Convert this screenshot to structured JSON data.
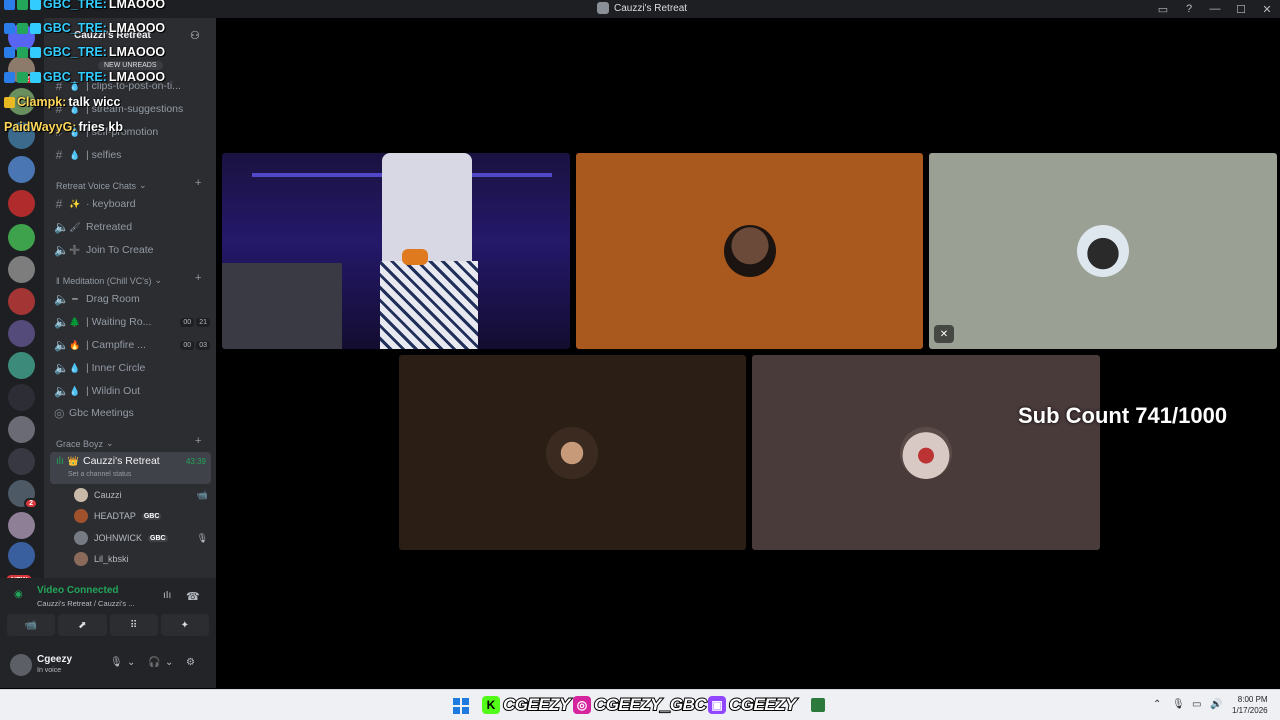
{
  "window": {
    "title": "Cauzzi's Retreat"
  },
  "server": {
    "name": "Cauzzi's Retreat",
    "new_unreads": "NEW UNREADS"
  },
  "rail": {
    "badges": [
      "27",
      "2"
    ],
    "new_label": "NEW"
  },
  "channels": [
    {
      "label": "| clips-to-post-on-ti...",
      "emoji": "💧"
    },
    {
      "label": "| stream-suggestions",
      "emoji": "💧"
    },
    {
      "label": "| self-promotion",
      "emoji": "💧"
    },
    {
      "label": "| selfies",
      "emoji": "💧"
    }
  ],
  "categories": {
    "retreat": "Retreat Voice Chats",
    "meditation": "Meditation (Chill VC's)",
    "grace": "Grace Boyz"
  },
  "retreat_channels": [
    {
      "label": "· keyboard",
      "emoji": "✨"
    },
    {
      "label": "Retreated",
      "emoji": "🖌"
    },
    {
      "label": "Join To Create",
      "emoji": "➕"
    }
  ],
  "meditation_channels": [
    {
      "label": "Drag Room",
      "emoji": "━",
      "counts": []
    },
    {
      "label": "| Waiting Ro...",
      "emoji": "🌲",
      "counts": [
        "00",
        "21"
      ]
    },
    {
      "label": "| Campfire ...",
      "emoji": "🔥",
      "counts": [
        "00",
        "03"
      ]
    },
    {
      "label": "| Inner Circle",
      "emoji": "💧",
      "counts": []
    },
    {
      "label": "| Wildin Out",
      "emoji": "💧",
      "counts": []
    },
    {
      "label": "Gbc Meetings",
      "emoji": "",
      "counts": []
    }
  ],
  "active_channel": {
    "name": "Cauzzi's Retreat",
    "time": "43:39",
    "status": "Set a channel status"
  },
  "members": [
    {
      "name": "Cauzzi",
      "tag": "",
      "icon": "📹",
      "color": "#c9b9a8"
    },
    {
      "name": "HEADTAP",
      "tag": "GBC",
      "icon": "",
      "color": "#a0522d"
    },
    {
      "name": "JOHNWICK",
      "tag": "GBC",
      "icon": "🎙",
      "color": "#777b83"
    },
    {
      "name": "Lil_kbski",
      "tag": "",
      "icon": "",
      "color": "#8a6b5a"
    }
  ],
  "voice": {
    "status": "Video Connected",
    "sub": "Cauzzi's Retreat / Cauzzi's ...",
    "buttons": [
      "📹",
      "⬈",
      "⠿",
      "✦"
    ]
  },
  "user": {
    "name": "Cgeezy",
    "status": "In voice"
  },
  "chat": [
    {
      "name": "GBC_TRE:",
      "msg": "LMAOOO",
      "color": "cyan"
    },
    {
      "name": "GBC_TRE:",
      "msg": "LMAOOO",
      "color": "cyan"
    },
    {
      "name": "GBC_TRE:",
      "msg": "LMAOOO",
      "color": "cyan"
    },
    {
      "name": "GBC_TRE:",
      "msg": "LMAOOO",
      "color": "cyan"
    },
    {
      "name": "Clampk:",
      "msg": "talk wicc",
      "color": "yellow"
    },
    {
      "name": "PaidWayyG:",
      "msg": "fries kb",
      "color": "yellow"
    }
  ],
  "overlay": {
    "sub_count": "Sub Count 741/1000"
  },
  "social": [
    {
      "platform": "kick",
      "handle": "CGEEZY",
      "color": "#53fc18",
      "glyph": "K"
    },
    {
      "platform": "instagram",
      "handle": "CGEEZY_GBC",
      "color": "#d6249f",
      "glyph": "◎"
    },
    {
      "platform": "twitch",
      "handle": "CGEEZY",
      "color": "#9146ff",
      "glyph": "▣"
    }
  ],
  "clock": {
    "time": "8:00 PM",
    "date": "1/17/2026"
  }
}
